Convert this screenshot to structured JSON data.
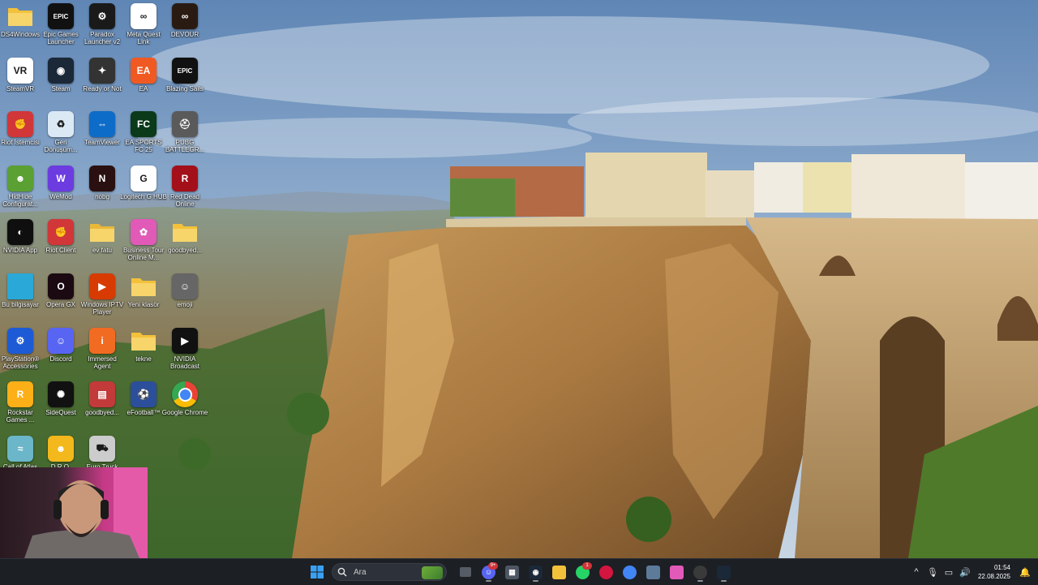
{
  "desktop_icons": [
    {
      "label": "DS4Windows",
      "icon": "folder-icon",
      "color": "#f3c13a"
    },
    {
      "label": "Epic Games Launcher",
      "icon": "epic-games-icon",
      "color": "#111111",
      "glyph": "EPIC"
    },
    {
      "label": "Paradox Launcher v2",
      "icon": "paradox-icon",
      "color": "#1a1a1a",
      "glyph": "⚙"
    },
    {
      "label": "Meta Quest Link",
      "icon": "meta-icon",
      "color": "#ffffff",
      "glyph": "∞"
    },
    {
      "label": "DEVOUR",
      "icon": "devour-icon",
      "color": "#2a1b12",
      "glyph": "∞"
    },
    {
      "label": "SteamVR",
      "icon": "steamvr-icon",
      "color": "#ffffff",
      "glyph": "VR"
    },
    {
      "label": "Steam",
      "icon": "steam-icon",
      "color": "#1b2838",
      "glyph": "◉"
    },
    {
      "label": "Ready or Not",
      "icon": "ready-or-not-icon",
      "color": "#333333",
      "glyph": "✦"
    },
    {
      "label": "EA",
      "icon": "ea-icon",
      "color": "#f05a22",
      "glyph": "EA"
    },
    {
      "label": "Blazing Sails",
      "icon": "blazing-sails-icon",
      "color": "#111111",
      "glyph": "EPIC"
    },
    {
      "label": "Riot İstemcisi",
      "icon": "riot-icon",
      "color": "#d13639",
      "glyph": "✊"
    },
    {
      "label": "Geri Dönüşüm...",
      "icon": "recycle-bin-icon",
      "color": "#dbe9f5",
      "glyph": "♻"
    },
    {
      "label": "TeamViewer",
      "icon": "teamviewer-icon",
      "color": "#0e6cc9",
      "glyph": "⇔"
    },
    {
      "label": "EA SPORTS FC 25",
      "icon": "ea-fc-icon",
      "color": "#0a3a1a",
      "glyph": "FC"
    },
    {
      "label": "PUBG BATTLEGR...",
      "icon": "pubg-icon",
      "color": "#5a5a5a",
      "glyph": "⛑"
    },
    {
      "label": "HidHide Configurat...",
      "icon": "hidhide-icon",
      "color": "#5aa032",
      "glyph": "☻"
    },
    {
      "label": "WeMod",
      "icon": "wemod-icon",
      "color": "#6c3ce0",
      "glyph": "W"
    },
    {
      "label": "nobg",
      "icon": "nobg-icon",
      "color": "#2a1010",
      "glyph": "N"
    },
    {
      "label": "Logitech G HUB",
      "icon": "logitech-icon",
      "color": "#ffffff",
      "glyph": "G"
    },
    {
      "label": "Red Dead Online",
      "icon": "red-dead-icon",
      "color": "#a3101a",
      "glyph": "R"
    },
    {
      "label": "NVIDIA App",
      "icon": "nvidia-icon",
      "color": "#0f0f0f",
      "glyph": "◐"
    },
    {
      "label": "Riot Client",
      "icon": "riot-client-icon",
      "color": "#d13639",
      "glyph": "✊"
    },
    {
      "label": "ev fatu",
      "icon": "folder-icon",
      "color": "#e8b83a"
    },
    {
      "label": "Business Tour Online M...",
      "icon": "business-tour-icon",
      "color": "#e15ab8",
      "glyph": "✿"
    },
    {
      "label": "goodbyed...",
      "icon": "folder-icon",
      "color": "#f3c13a"
    },
    {
      "label": "Bu bilgisayar",
      "icon": "computer-icon",
      "color": "#2aa9d8",
      "glyph": ""
    },
    {
      "label": "Opera GX",
      "icon": "opera-gx-icon",
      "color": "#1b0a12",
      "glyph": "O"
    },
    {
      "label": "Windows IPTV Player",
      "icon": "iptv-icon",
      "color": "#d83b01",
      "glyph": "▶"
    },
    {
      "label": "Yeni klasör",
      "icon": "folder-icon",
      "color": "#f3c13a"
    },
    {
      "label": "emoji",
      "icon": "emoji-file-icon",
      "color": "#666666",
      "glyph": "☺"
    },
    {
      "label": "PlayStation® Accessories",
      "icon": "playstation-icon",
      "color": "#1d5bd6",
      "glyph": "⚙"
    },
    {
      "label": "Discord",
      "icon": "discord-icon",
      "color": "#5865f2",
      "glyph": "☺"
    },
    {
      "label": "Immersed Agent",
      "icon": "immersed-icon",
      "color": "#f26b22",
      "glyph": "i"
    },
    {
      "label": "tekne",
      "icon": "folder-icon",
      "color": "#f3c13a"
    },
    {
      "label": "NVIDIA Broadcast",
      "icon": "nvidia-broadcast-icon",
      "color": "#111111",
      "glyph": "▶"
    },
    {
      "label": "Rockstar Games ...",
      "icon": "rockstar-icon",
      "color": "#fcaf17",
      "glyph": "R"
    },
    {
      "label": "SideQuest",
      "icon": "sidequest-icon",
      "color": "#111111",
      "glyph": "✺"
    },
    {
      "label": "goodbyed...",
      "icon": "archive-icon",
      "color": "#c23a3a",
      "glyph": "▤"
    },
    {
      "label": "eFootball™",
      "icon": "efootball-icon",
      "color": "#2b4f9a",
      "glyph": "⚽"
    },
    {
      "label": "Google Chrome",
      "icon": "chrome-icon",
      "color": "#ffffff",
      "glyph": ""
    },
    {
      "label": "Call of Atlas",
      "icon": "call-of-atlas-icon",
      "color": "#6bb6c9",
      "glyph": "≈"
    },
    {
      "label": "D.R.O.",
      "icon": "dro-icon",
      "color": "#f3b81c",
      "glyph": "☻"
    },
    {
      "label": "Euro Truck Simulator 2",
      "icon": "ets2-icon",
      "color": "#cccccc",
      "glyph": "⛟"
    }
  ],
  "search": {
    "placeholder": "Ara"
  },
  "taskbar_apps": [
    {
      "name": "file-explorer-button",
      "icon": "file-explorer-icon",
      "color": "#f3c13a"
    },
    {
      "name": "whatsapp-button",
      "icon": "whatsapp-icon",
      "color": "#25d366",
      "badge": "1"
    },
    {
      "name": "opera-gx-taskbar-button",
      "icon": "opera-gx-icon",
      "color": "#d4153f"
    },
    {
      "name": "chrome-taskbar-button",
      "icon": "chrome-icon",
      "color": "#4285f4"
    },
    {
      "name": "app-taskbar-button",
      "icon": "app-icon",
      "color": "#5d7a99"
    },
    {
      "name": "business-tour-taskbar-button",
      "icon": "business-tour-icon",
      "color": "#e15ab8"
    },
    {
      "name": "obs-taskbar-button",
      "icon": "obs-icon",
      "color": "#3a3a3a"
    },
    {
      "name": "steam-taskbar-button",
      "icon": "steam-icon",
      "color": "#1b2838"
    }
  ],
  "clock": {
    "time": "01:54",
    "date": "22.08.2025"
  },
  "colors": {
    "taskbar": "#1c1f24",
    "accent": "#0078d4"
  }
}
